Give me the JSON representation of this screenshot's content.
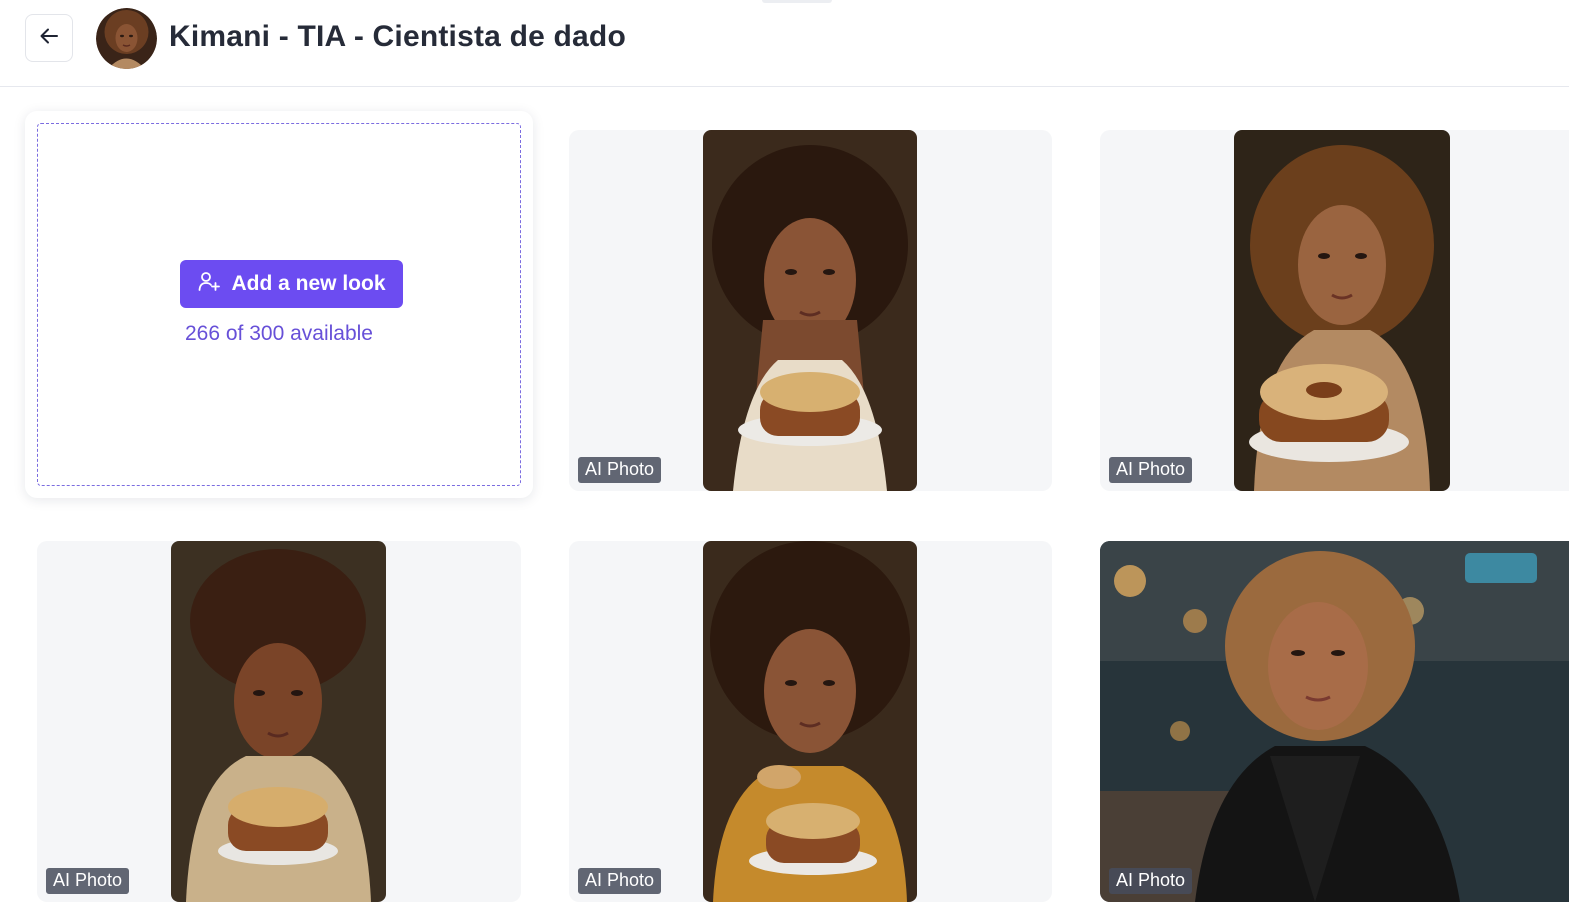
{
  "header": {
    "title": "Kimani - TIA - Cientista de dado",
    "back_icon": "arrow-left-icon"
  },
  "add_card": {
    "button_label": "Add a new look",
    "button_icon": "add-user-icon",
    "availability": "266 of 300 available",
    "accent_color": "#6c4cf1"
  },
  "photos": [
    {
      "badge": "AI Photo"
    },
    {
      "badge": "AI Photo"
    },
    {
      "badge": "AI Photo"
    },
    {
      "badge": "AI Photo"
    },
    {
      "badge": "AI Photo"
    }
  ]
}
